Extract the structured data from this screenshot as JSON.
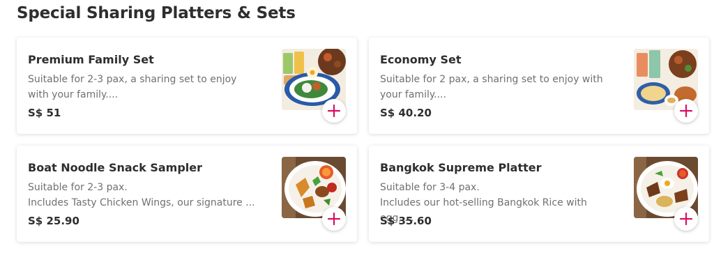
{
  "section": {
    "title": "Special Sharing Platters & Sets"
  },
  "colors": {
    "accent": "#d70f64",
    "text": "#2e2e2e",
    "muted": "#707070"
  },
  "items": [
    {
      "name": "Premium Family Set",
      "description": "Suitable for 2-3 pax, a sharing set to enjoy with your family....",
      "price": "S$ 51",
      "image_icon": "food-photo-icon",
      "add_icon": "plus-icon"
    },
    {
      "name": "Economy Set",
      "description": "Suitable for 2 pax, a sharing set to enjoy with your family....",
      "price": "S$ 40.20",
      "image_icon": "food-photo-icon",
      "add_icon": "plus-icon"
    },
    {
      "name": "Boat Noodle Snack Sampler",
      "description": "Suitable for 2-3 pax.\nIncludes Tasty Chicken Wings, our signature ...",
      "price": "S$ 25.90",
      "image_icon": "food-photo-icon",
      "add_icon": "plus-icon"
    },
    {
      "name": "Bangkok Supreme Platter",
      "description": "Suitable for 3-4 pax.\nIncludes our hot-selling Bangkok Rice with egg, ...",
      "price": "S$ 35.60",
      "image_icon": "food-photo-icon",
      "add_icon": "plus-icon"
    }
  ]
}
